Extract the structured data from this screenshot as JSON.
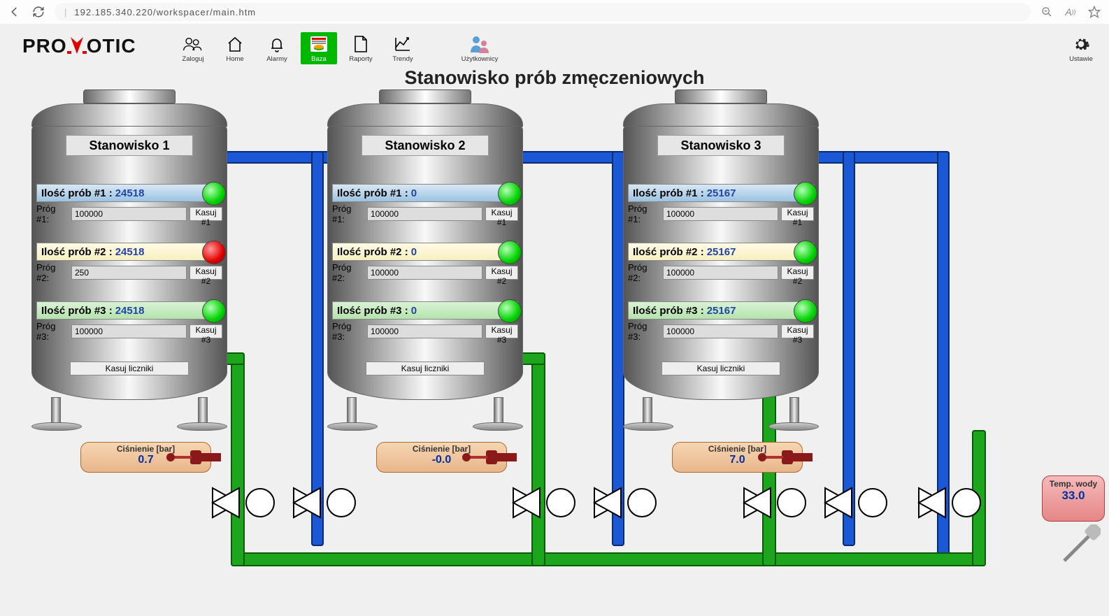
{
  "browser": {
    "url": "192.185.340.220/workspacer/main.htm"
  },
  "brand": {
    "pre": "PRO",
    "post": "OTIC"
  },
  "menu": {
    "items": [
      {
        "label": "Zaloguj"
      },
      {
        "label": "Home"
      },
      {
        "label": "Alarmy"
      },
      {
        "label": "Baza"
      },
      {
        "label": "Raporty"
      },
      {
        "label": "Trendy"
      },
      {
        "label": "Użytkownicy"
      }
    ],
    "settings": "Ustawie"
  },
  "title": "Stanowisko prób zmęczeniowych",
  "labels": {
    "count1": "Ilość prób #1 : ",
    "count2": "Ilość prób #2 : ",
    "count3": "Ilość prób #3 : ",
    "th1": "Próg #1:",
    "th2": "Próg #2:",
    "th3": "Próg #3:",
    "reset1": "Kasuj #1",
    "reset2": "Kasuj #2",
    "reset3": "Kasuj #3",
    "resetAll": "Kasuj liczniki",
    "pressure": "Ciśnienie [bar]",
    "temperature": "Temp. wody"
  },
  "stations": [
    {
      "name": "Stanowisko 1",
      "c1": "24518",
      "s1": "on",
      "c2": "24518",
      "s2": "off",
      "c3": "24518",
      "s3": "on",
      "t1": "100000",
      "t2": "250",
      "t3": "100000",
      "pressure": "0.7"
    },
    {
      "name": "Stanowisko 2",
      "c1": "0",
      "s1": "on",
      "c2": "0",
      "s2": "on",
      "c3": "0",
      "s3": "on",
      "t1": "100000",
      "t2": "100000",
      "t3": "100000",
      "pressure": "-0.0"
    },
    {
      "name": "Stanowisko 3",
      "c1": "25167",
      "s1": "on",
      "c2": "25167",
      "s2": "on",
      "c3": "25167",
      "s3": "on",
      "t1": "100000",
      "t2": "100000",
      "t3": "100000",
      "pressure": "7.0"
    }
  ],
  "temperature": "33.0"
}
